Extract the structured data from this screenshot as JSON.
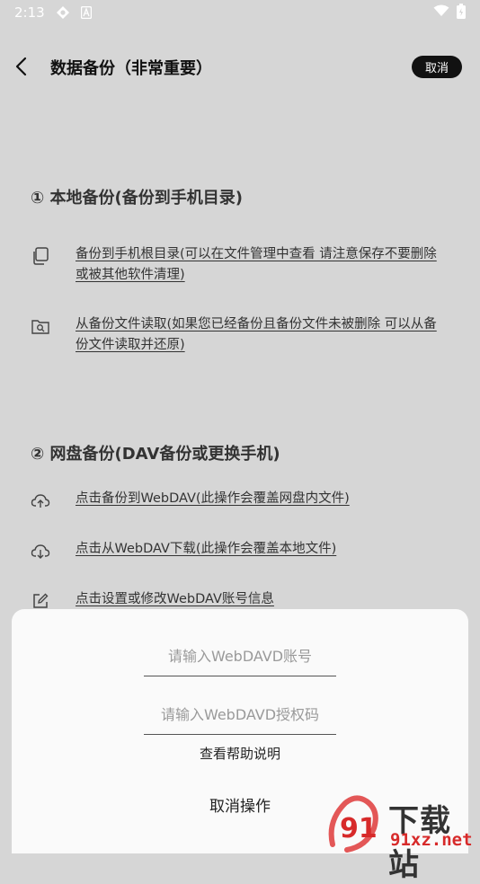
{
  "status_bar": {
    "time": "2:13"
  },
  "header": {
    "title": "数据备份（非常重要）",
    "cancel_label": "取消"
  },
  "local_section": {
    "title": "① 本地备份(备份到手机目录)",
    "items": [
      {
        "label": "备份到手机根目录(可以在文件管理中查看 请注意保存不要删除或被其他软件清理)",
        "icon": "copy-icon"
      },
      {
        "label": "从备份文件读取(如果您已经备份且备份文件未被删除 可以从备份文件读取并还原)",
        "icon": "folder-search-icon"
      }
    ]
  },
  "cloud_section": {
    "title": "② 网盘备份(DAV备份或更换手机)",
    "items": [
      {
        "label": "点击备份到WebDAV(此操作会覆盖网盘内文件)",
        "icon": "cloud-upload-icon"
      },
      {
        "label": "点击从WebDAV下载(此操作会覆盖本地文件)",
        "icon": "cloud-download-icon"
      },
      {
        "label": "点击设置或修改WebDAV账号信息",
        "icon": "edit-icon"
      }
    ]
  },
  "sheet": {
    "account_placeholder": "请输入WebDAVD账号",
    "token_placeholder": "请输入WebDAVD授权码",
    "help_label": "查看帮助说明",
    "cancel_label": "取消操作"
  },
  "watermark": {
    "brand": "下载站",
    "domain": "91xz.net",
    "logo_digits": "91"
  }
}
